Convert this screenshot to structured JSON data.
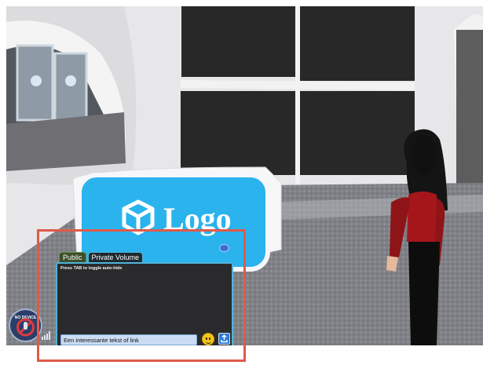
{
  "chat": {
    "tabs": [
      {
        "label": "Public",
        "active": true
      },
      {
        "label": "Private Volume",
        "active": false
      }
    ],
    "hint": "Press TAB to toggle auto-hide",
    "input_value": "Een interessante tekst of link"
  },
  "sign": {
    "text": "Logo"
  },
  "status": {
    "device_label": "NO DEVICE"
  },
  "icons": {
    "emoji": "smiley-face-icon",
    "send": "upload-icon",
    "hud": "collapse-icon",
    "device": "mic-off-icon",
    "signal": "signal-bars-icon"
  },
  "colors": {
    "chat_border": "#4fb3d8",
    "input_bg": "#c9dcf3",
    "sign_blue": "#2bb3ee",
    "highlight": "#e05a4a",
    "avatar_red": "#a5161b"
  }
}
